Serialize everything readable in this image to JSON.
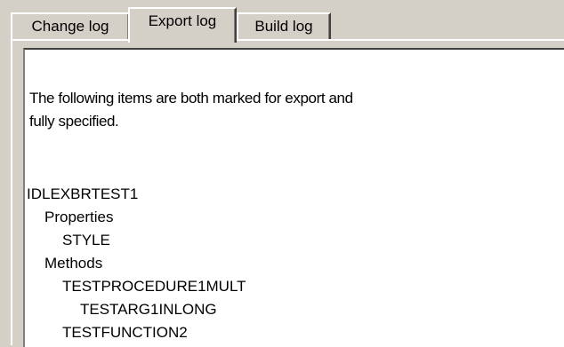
{
  "tabs": [
    {
      "label": "Change log",
      "active": false
    },
    {
      "label": "Export log",
      "active": true
    },
    {
      "label": "Build log",
      "active": false
    }
  ],
  "log": {
    "intro_line1": "The following items are both marked for export and",
    "intro_line2": "fully specified.",
    "tree": [
      {
        "text": "IDLEXBRTEST1",
        "level": 0
      },
      {
        "text": "Properties",
        "level": 1
      },
      {
        "text": "STYLE",
        "level": 2
      },
      {
        "text": "Methods",
        "level": 1
      },
      {
        "text": "TESTPROCEDURE1MULT",
        "level": 2
      },
      {
        "text": "TESTARG1INLONG",
        "level": 3
      },
      {
        "text": "TESTFUNCTION2",
        "level": 2
      }
    ]
  },
  "colors": {
    "face": "#d4d0c8",
    "highlight": "#ffffff",
    "shadow": "#808080",
    "dark_shadow": "#404040",
    "window": "#ffffff"
  }
}
